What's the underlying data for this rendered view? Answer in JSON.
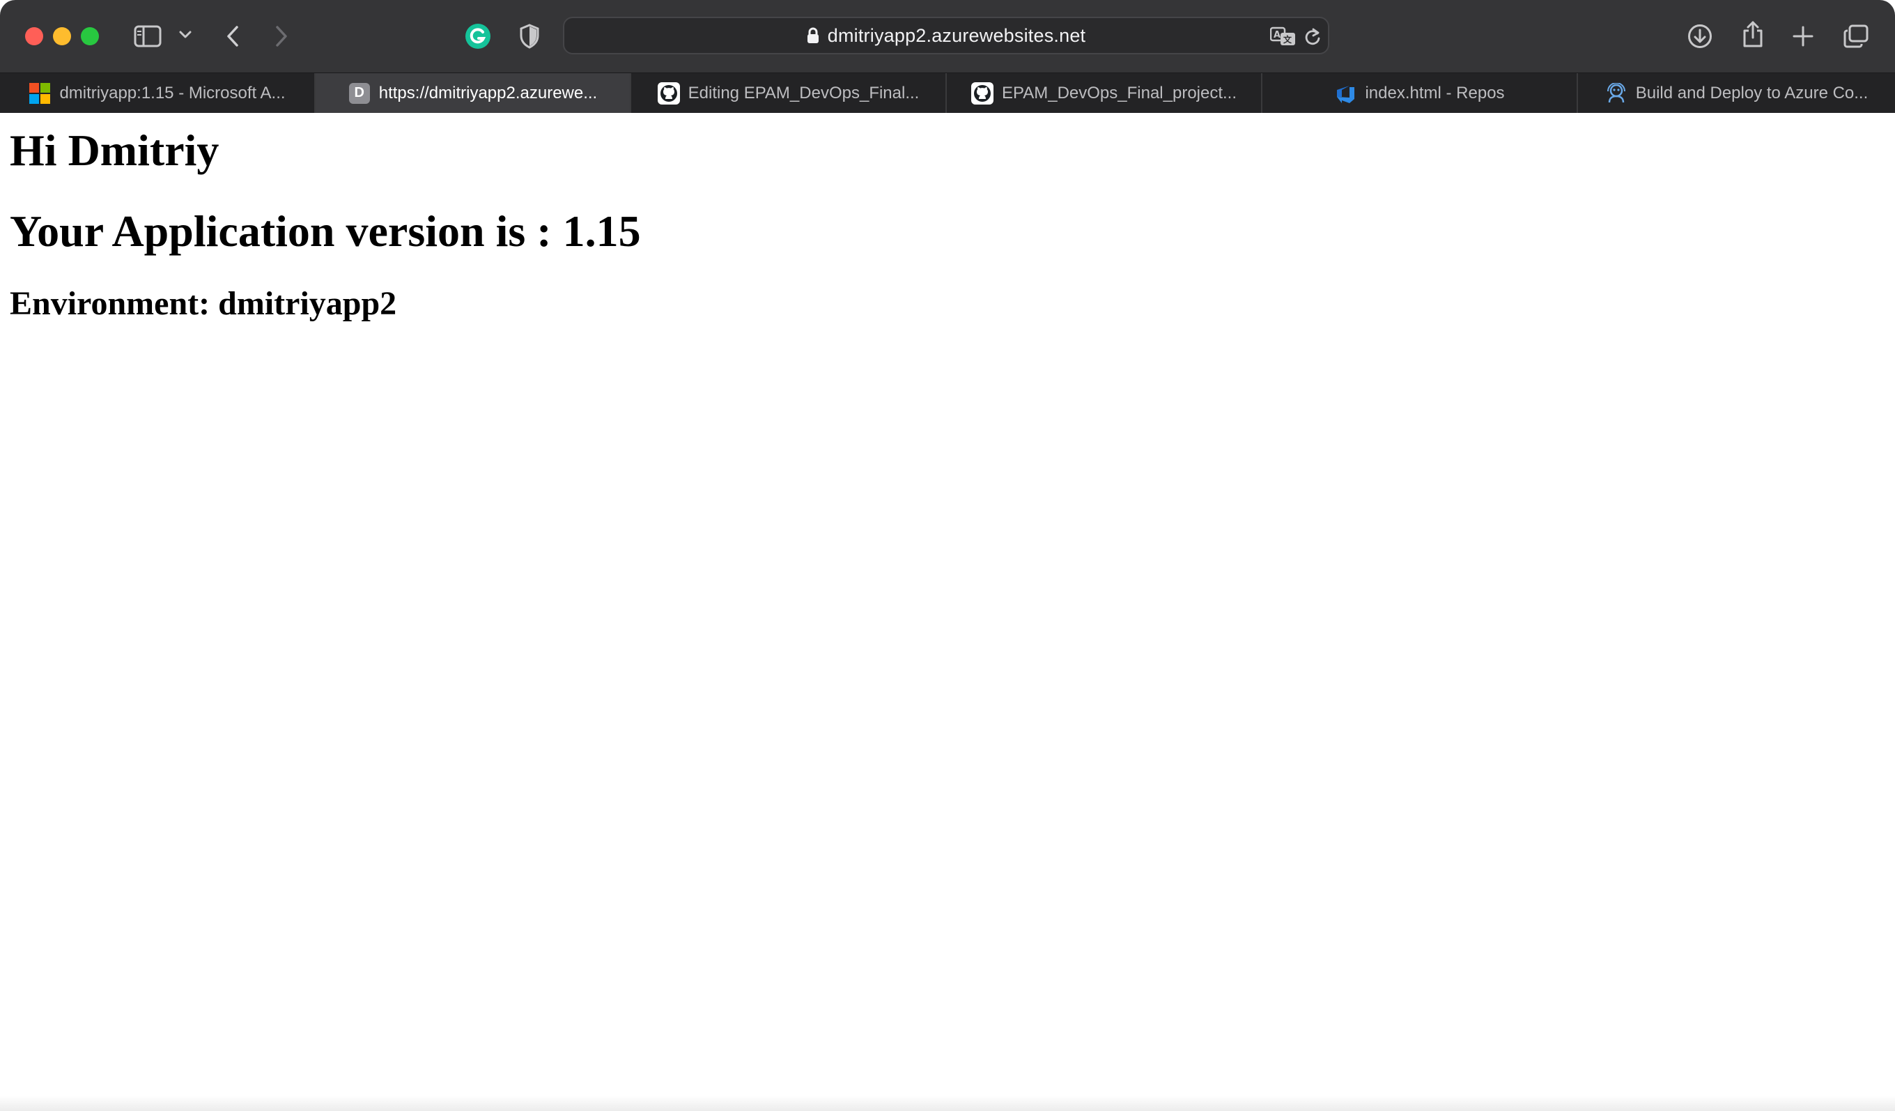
{
  "browser": {
    "url": "dmitriyapp2.azurewebsites.net",
    "window_controls": [
      "close",
      "minimize",
      "zoom"
    ],
    "toolbar_icons": {
      "sidebar": "sidebar-icon",
      "tab_group_menu": "chevron-down-icon",
      "back": "chevron-left-icon",
      "forward": "chevron-right-icon",
      "grammarly": "grammarly-icon",
      "privacy": "shield-icon",
      "translate": "translate-icon",
      "reload": "reload-icon",
      "downloads": "download-icon",
      "share": "share-icon",
      "new_tab": "plus-icon",
      "tab_overview": "tab-overview-icon"
    }
  },
  "tabs": [
    {
      "label": "dmitriyapp:1.15 - Microsoft A...",
      "icon": "microsoft-icon",
      "active": false
    },
    {
      "label": "https://dmitriyapp2.azurewe...",
      "icon": "letter-d-icon",
      "favicon_letter": "D",
      "active": true
    },
    {
      "label": "Editing EPAM_DevOps_Final...",
      "icon": "github-icon",
      "active": false
    },
    {
      "label": "EPAM_DevOps_Final_project...",
      "icon": "github-icon",
      "active": false
    },
    {
      "label": "index.html - Repos",
      "icon": "azure-devops-icon",
      "active": false
    },
    {
      "label": "Build and Deploy to Azure Co...",
      "icon": "azure-pipelines-icon",
      "active": false
    }
  ],
  "page": {
    "greeting": "Hi Dmitriy",
    "version_line": "Your Application version is : 1.15",
    "environment_line": "Environment: dmitriyapp2"
  },
  "colors": {
    "toolbar_bg": "#353537",
    "tabbar_bg": "#232325",
    "active_tab_bg": "#3d3d40",
    "close": "#ff5f57",
    "minimize": "#febc2e",
    "zoom": "#28c840",
    "grammarly": "#15c39a"
  }
}
